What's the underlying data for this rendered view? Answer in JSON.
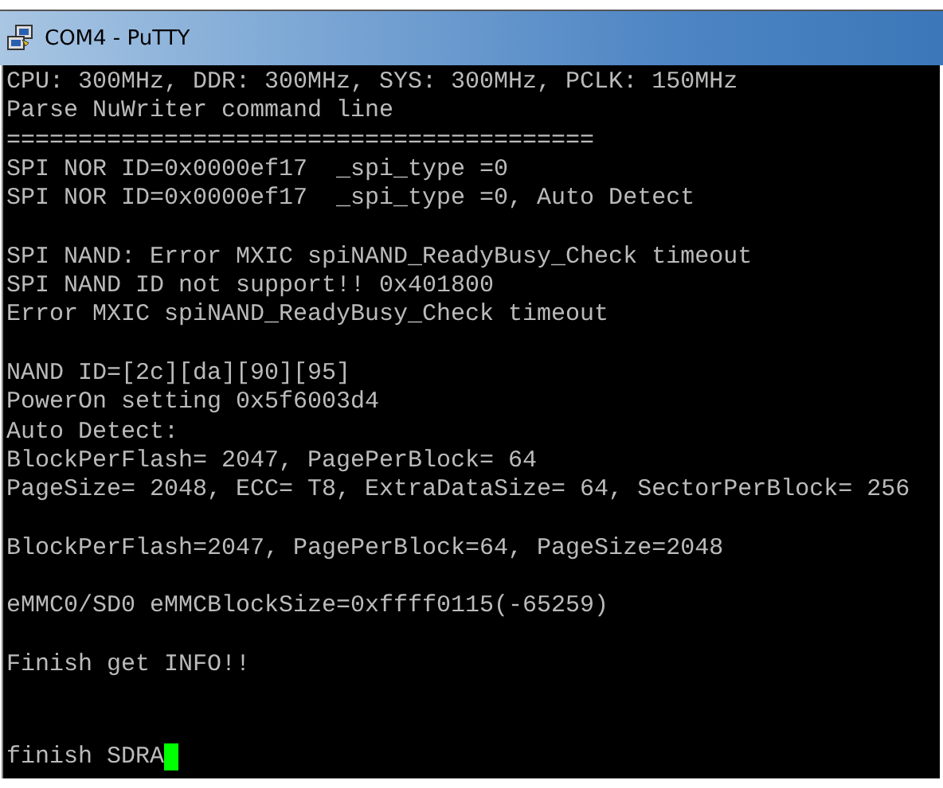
{
  "window": {
    "title": "COM4 - PuTTY"
  },
  "terminal": {
    "blocks": [
      [
        "CPU: 300MHz, DDR: 300MHz, SYS: 300MHz, PCLK: 150MHz",
        "Parse NuWriter command line",
        "=========================================",
        "SPI NOR ID=0x0000ef17  _spi_type =0",
        "SPI NOR ID=0x0000ef17  _spi_type =0, Auto Detect"
      ],
      [
        "SPI NAND: Error MXIC spiNAND_ReadyBusy_Check timeout",
        "SPI NAND ID not support!! 0x401800",
        "Error MXIC spiNAND_ReadyBusy_Check timeout"
      ],
      [
        "NAND ID=[2c][da][90][95]",
        "PowerOn setting 0x5f6003d4",
        "Auto Detect:",
        "BlockPerFlash= 2047, PagePerBlock= 64",
        "PageSize= 2048, ECC= T8, ExtraDataSize= 64, SectorPerBlock= 256"
      ],
      [
        "BlockPerFlash=2047, PagePerBlock=64, PageSize=2048"
      ],
      [
        "eMMC0/SD0 eMMCBlockSize=0xffff0115(-65259)"
      ],
      [
        "Finish get INFO!!"
      ]
    ],
    "prompt": {
      "text": "finish SDRA",
      "cursor": true
    }
  }
}
